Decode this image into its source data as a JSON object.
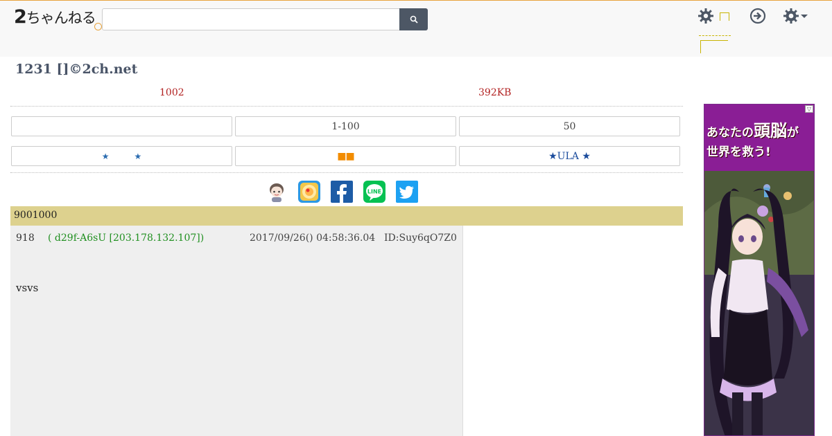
{
  "header": {
    "logo_prefix": "2",
    "logo_text": "ちゃんねる",
    "search": {
      "placeholder": "",
      "value": ""
    }
  },
  "thread": {
    "title": "1231 []©2ch.net",
    "res_count": "1002",
    "size": "392KB"
  },
  "nav_row1": {
    "all": "",
    "range": "1-100",
    "latest": "50"
  },
  "nav_row2": {
    "fav_left": "★",
    "fav_right": "★",
    "squares": "■■",
    "ula": "★ULA ★"
  },
  "notice": "9001000",
  "post": {
    "number": "918",
    "name": "( d29f-A6sU [203.178.132.107])",
    "date": "2017/09/26() 04:58:36.04",
    "id": "ID:Suy6qO7Z0",
    "body": "vsvs"
  },
  "ad": {
    "headline_a": "あなたの",
    "headline_big": "頭脳",
    "headline_b": "が",
    "headline_c": "世界を救う!",
    "choice": "▽"
  },
  "colors": {
    "accent": "#e8a33d",
    "notice_bg": "#ddd18e",
    "meta_red": "#b22222",
    "post_name": "#1f8f1f"
  },
  "icons": [
    "search-icon",
    "gear-icon",
    "login-icon",
    "settings-menu-icon",
    "facebook-icon",
    "line-icon",
    "twitter-icon"
  ]
}
